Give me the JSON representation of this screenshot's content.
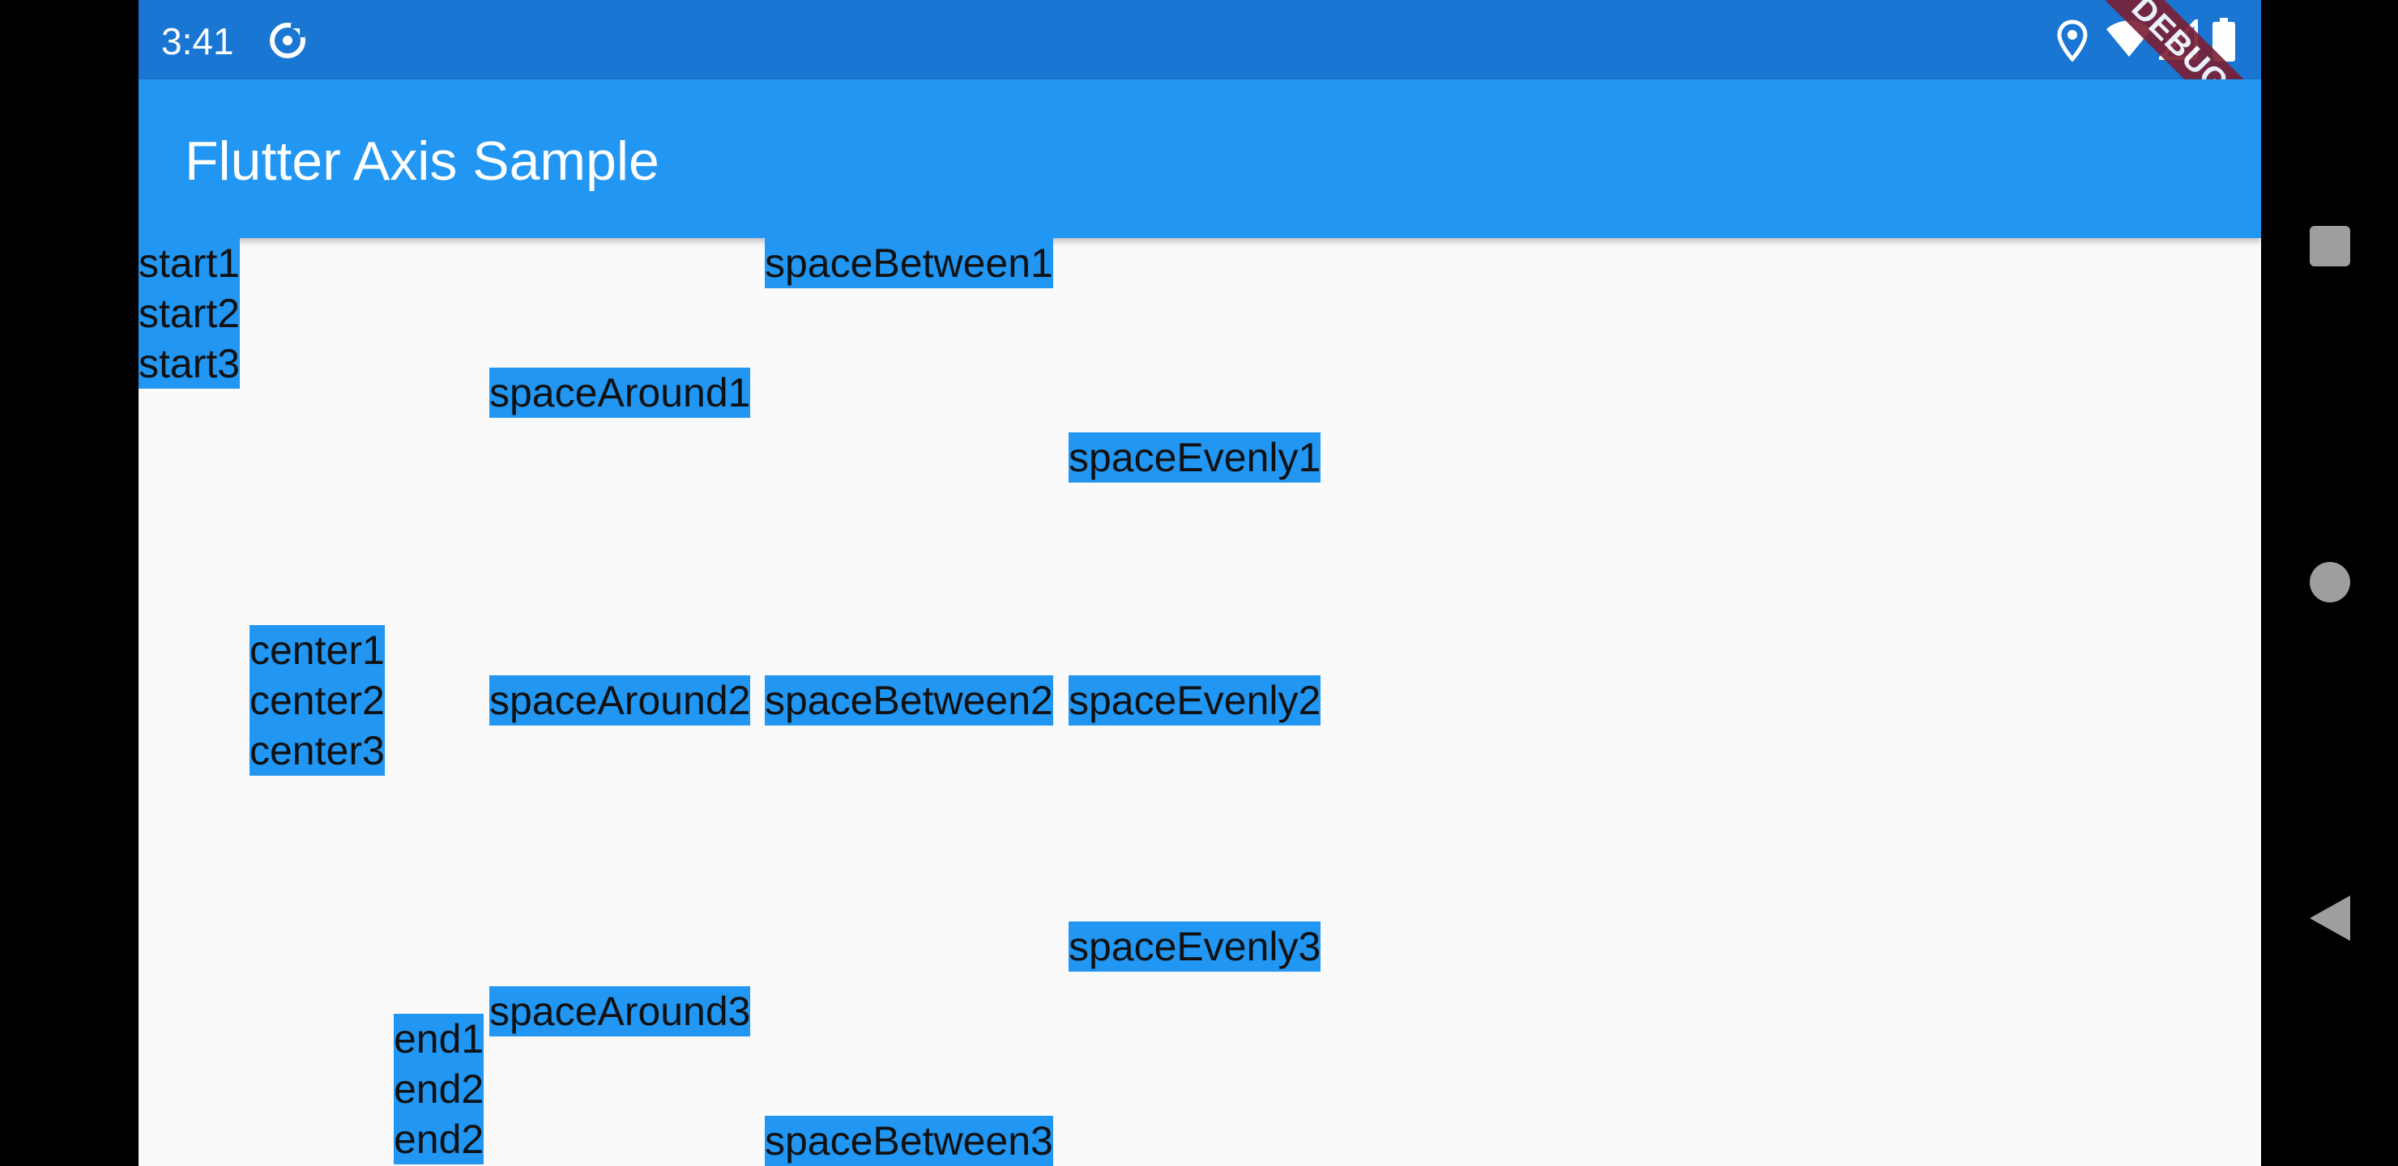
{
  "status_bar": {
    "time": "3:41",
    "icons": [
      "notification-assistant-icon",
      "location-icon",
      "wifi-icon",
      "signal-icon",
      "battery-icon"
    ]
  },
  "app_bar": {
    "title": "Flutter Axis Sample"
  },
  "debug_banner": "DEBUG",
  "columns": {
    "start": [
      "start1",
      "start2",
      "start3"
    ],
    "center": [
      "center1",
      "center2",
      "center3"
    ],
    "end": [
      "end1",
      "end2",
      "end2"
    ],
    "space_around": [
      "spaceAround1",
      "spaceAround2",
      "spaceAround3"
    ],
    "space_between": [
      "spaceBetween1",
      "spaceBetween2",
      "spaceBetween3"
    ],
    "space_evenly": [
      "spaceEvenly1",
      "spaceEvenly2",
      "spaceEvenly3"
    ]
  },
  "nav_bar": {
    "buttons": [
      "recents-icon",
      "home-icon",
      "back-icon"
    ]
  },
  "colors": {
    "status_bar": "#1976d2",
    "app_bar": "#2196f3",
    "item_bg": "#2196f3",
    "page_bg": "#fafafa"
  }
}
